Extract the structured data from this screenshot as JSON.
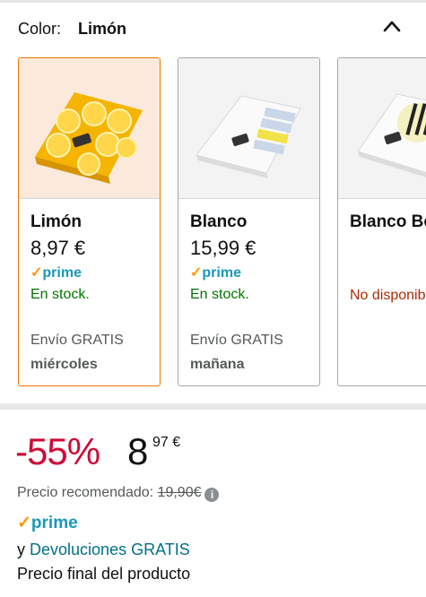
{
  "color_selector": {
    "label": "Color:",
    "selected": "Limón"
  },
  "variants": [
    {
      "name": "Limón",
      "price": "8,97 €",
      "prime": "prime",
      "stock": "En stock.",
      "shipping": "Envío GRATIS",
      "day": "miércoles"
    },
    {
      "name": "Blanco",
      "price": "15,99 €",
      "prime": "prime",
      "stock": "En stock.",
      "shipping": "Envío GRATIS",
      "day": "mañana"
    },
    {
      "name": "Blanco Bo",
      "stock": "No disponible."
    }
  ],
  "price_block": {
    "discount": "-55%",
    "price_whole": "8",
    "price_fraction": "97 €",
    "rrp_label": "Precio recomendado:",
    "rrp_value": "19,90€",
    "info_icon": "i",
    "prime": "prime",
    "returns_prefix": "y",
    "returns_link": "Devoluciones GRATIS",
    "final_price": "Precio final del producto"
  },
  "colors": {
    "prime_blue": "#1a98b8",
    "prime_check": "#ff9900",
    "in_stock": "#007600",
    "out_of_stock": "#b12704",
    "discount_red": "#cc0c39",
    "selected_border": "#e77600",
    "link": "#007185"
  },
  "icons": [
    "chevron-up-icon",
    "info-icon",
    "prime-check-icon"
  ]
}
